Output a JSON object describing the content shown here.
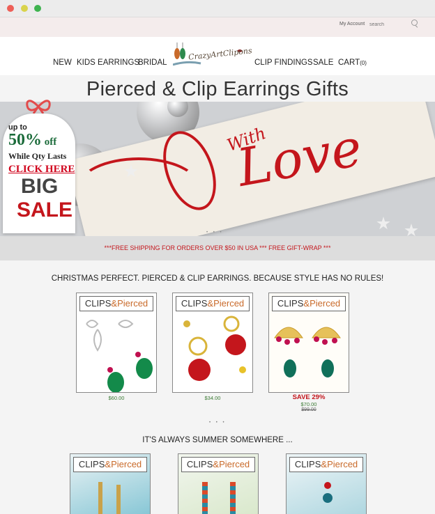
{
  "topbar": {
    "account": "My Account",
    "search_placeholder": "search"
  },
  "nav": {
    "left": [
      "NEW",
      "KIDS EARRINGS",
      "BRIDAL"
    ],
    "logo": "CrazyArtClipons",
    "right": [
      "CLIP FINDINGS",
      "SALE"
    ],
    "cart_label": "CART",
    "cart_count": "(0)"
  },
  "hero": {
    "title": "Pierced & Clip Earrings Gifts",
    "script_small": "With",
    "script_big": "Love"
  },
  "promo": {
    "line1": "up to",
    "percent": "50%",
    "off": " off",
    "qty": "While Qty Lasts",
    "cta": "CLICK HERE",
    "big": "BIG",
    "sale": "SALE"
  },
  "shipping": "***FREE SHIPPING FOR ORDERS OVER $50 IN USA *** FREE GIFT-WRAP ***",
  "section1": {
    "title": "CHRISTMAS PERFECT. PIERCED & CLIP EARRINGS. BECAUSE STYLE HAS NO RULES!",
    "products": [
      {
        "brand_a": "CLIPS",
        "brand_b": "&Pierced",
        "price": "$60.00",
        "save": "",
        "old": ""
      },
      {
        "brand_a": "CLIPS",
        "brand_b": "&Pierced",
        "price": "$34.00",
        "save": "",
        "old": ""
      },
      {
        "brand_a": "CLIPS",
        "brand_b": "&Pierced",
        "price": "$70.00",
        "save": "SAVE 29%",
        "old": "$99.00"
      }
    ]
  },
  "section2": {
    "title": "IT'S ALWAYS SUMMER SOMEWHERE ...",
    "products": [
      {
        "brand_a": "CLIPS",
        "brand_b": "&Pierced"
      },
      {
        "brand_a": "CLIPS",
        "brand_b": "&Pierced"
      },
      {
        "brand_a": "CLIPS",
        "brand_b": "&Pierced"
      }
    ]
  },
  "colors": {
    "accent": "#c4161c",
    "price": "#3a7a33"
  }
}
